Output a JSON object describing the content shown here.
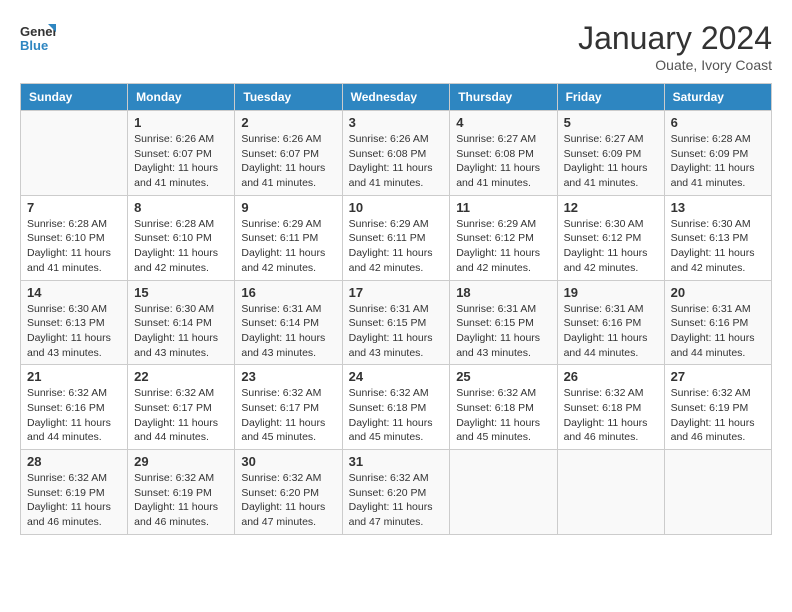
{
  "header": {
    "logo_general": "General",
    "logo_blue": "Blue",
    "month_title": "January 2024",
    "subtitle": "Ouate, Ivory Coast"
  },
  "days_of_week": [
    "Sunday",
    "Monday",
    "Tuesday",
    "Wednesday",
    "Thursday",
    "Friday",
    "Saturday"
  ],
  "weeks": [
    [
      {
        "day": "",
        "info": ""
      },
      {
        "day": "1",
        "info": "Sunrise: 6:26 AM\nSunset: 6:07 PM\nDaylight: 11 hours and 41 minutes."
      },
      {
        "day": "2",
        "info": "Sunrise: 6:26 AM\nSunset: 6:07 PM\nDaylight: 11 hours and 41 minutes."
      },
      {
        "day": "3",
        "info": "Sunrise: 6:26 AM\nSunset: 6:08 PM\nDaylight: 11 hours and 41 minutes."
      },
      {
        "day": "4",
        "info": "Sunrise: 6:27 AM\nSunset: 6:08 PM\nDaylight: 11 hours and 41 minutes."
      },
      {
        "day": "5",
        "info": "Sunrise: 6:27 AM\nSunset: 6:09 PM\nDaylight: 11 hours and 41 minutes."
      },
      {
        "day": "6",
        "info": "Sunrise: 6:28 AM\nSunset: 6:09 PM\nDaylight: 11 hours and 41 minutes."
      }
    ],
    [
      {
        "day": "7",
        "info": "Sunrise: 6:28 AM\nSunset: 6:10 PM\nDaylight: 11 hours and 41 minutes."
      },
      {
        "day": "8",
        "info": "Sunrise: 6:28 AM\nSunset: 6:10 PM\nDaylight: 11 hours and 42 minutes."
      },
      {
        "day": "9",
        "info": "Sunrise: 6:29 AM\nSunset: 6:11 PM\nDaylight: 11 hours and 42 minutes."
      },
      {
        "day": "10",
        "info": "Sunrise: 6:29 AM\nSunset: 6:11 PM\nDaylight: 11 hours and 42 minutes."
      },
      {
        "day": "11",
        "info": "Sunrise: 6:29 AM\nSunset: 6:12 PM\nDaylight: 11 hours and 42 minutes."
      },
      {
        "day": "12",
        "info": "Sunrise: 6:30 AM\nSunset: 6:12 PM\nDaylight: 11 hours and 42 minutes."
      },
      {
        "day": "13",
        "info": "Sunrise: 6:30 AM\nSunset: 6:13 PM\nDaylight: 11 hours and 42 minutes."
      }
    ],
    [
      {
        "day": "14",
        "info": "Sunrise: 6:30 AM\nSunset: 6:13 PM\nDaylight: 11 hours and 43 minutes."
      },
      {
        "day": "15",
        "info": "Sunrise: 6:30 AM\nSunset: 6:14 PM\nDaylight: 11 hours and 43 minutes."
      },
      {
        "day": "16",
        "info": "Sunrise: 6:31 AM\nSunset: 6:14 PM\nDaylight: 11 hours and 43 minutes."
      },
      {
        "day": "17",
        "info": "Sunrise: 6:31 AM\nSunset: 6:15 PM\nDaylight: 11 hours and 43 minutes."
      },
      {
        "day": "18",
        "info": "Sunrise: 6:31 AM\nSunset: 6:15 PM\nDaylight: 11 hours and 43 minutes."
      },
      {
        "day": "19",
        "info": "Sunrise: 6:31 AM\nSunset: 6:16 PM\nDaylight: 11 hours and 44 minutes."
      },
      {
        "day": "20",
        "info": "Sunrise: 6:31 AM\nSunset: 6:16 PM\nDaylight: 11 hours and 44 minutes."
      }
    ],
    [
      {
        "day": "21",
        "info": "Sunrise: 6:32 AM\nSunset: 6:16 PM\nDaylight: 11 hours and 44 minutes."
      },
      {
        "day": "22",
        "info": "Sunrise: 6:32 AM\nSunset: 6:17 PM\nDaylight: 11 hours and 44 minutes."
      },
      {
        "day": "23",
        "info": "Sunrise: 6:32 AM\nSunset: 6:17 PM\nDaylight: 11 hours and 45 minutes."
      },
      {
        "day": "24",
        "info": "Sunrise: 6:32 AM\nSunset: 6:18 PM\nDaylight: 11 hours and 45 minutes."
      },
      {
        "day": "25",
        "info": "Sunrise: 6:32 AM\nSunset: 6:18 PM\nDaylight: 11 hours and 45 minutes."
      },
      {
        "day": "26",
        "info": "Sunrise: 6:32 AM\nSunset: 6:18 PM\nDaylight: 11 hours and 46 minutes."
      },
      {
        "day": "27",
        "info": "Sunrise: 6:32 AM\nSunset: 6:19 PM\nDaylight: 11 hours and 46 minutes."
      }
    ],
    [
      {
        "day": "28",
        "info": "Sunrise: 6:32 AM\nSunset: 6:19 PM\nDaylight: 11 hours and 46 minutes."
      },
      {
        "day": "29",
        "info": "Sunrise: 6:32 AM\nSunset: 6:19 PM\nDaylight: 11 hours and 46 minutes."
      },
      {
        "day": "30",
        "info": "Sunrise: 6:32 AM\nSunset: 6:20 PM\nDaylight: 11 hours and 47 minutes."
      },
      {
        "day": "31",
        "info": "Sunrise: 6:32 AM\nSunset: 6:20 PM\nDaylight: 11 hours and 47 minutes."
      },
      {
        "day": "",
        "info": ""
      },
      {
        "day": "",
        "info": ""
      },
      {
        "day": "",
        "info": ""
      }
    ]
  ]
}
